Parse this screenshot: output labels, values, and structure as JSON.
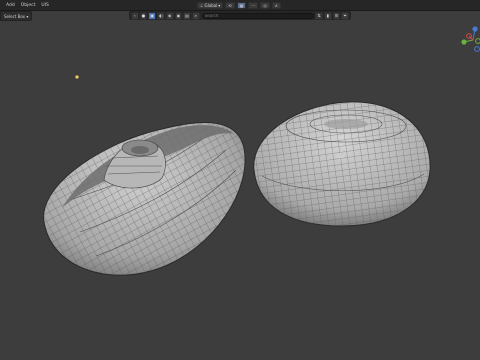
{
  "menu": {
    "items": [
      "Add",
      "Object",
      "UIS"
    ]
  },
  "header": {
    "transform_orientation": "Global",
    "select_mode": "Select Box"
  },
  "viewport_header": {
    "search_placeholder": "Search"
  },
  "colors": {
    "viewport_bg": "#3d3d3d",
    "mesh_fill": "#bcbcbc",
    "wire": "#5a5a5a",
    "light_dot": "#f0d060",
    "axis_x": "#d04a4a",
    "axis_y": "#6ab040",
    "axis_z": "#4a7ad0"
  }
}
